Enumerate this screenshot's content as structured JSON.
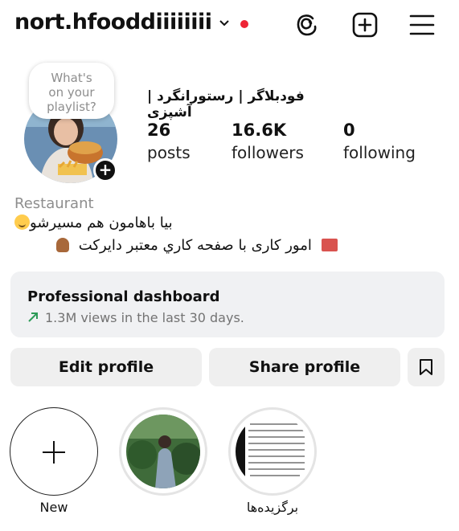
{
  "header": {
    "username": "nort.hfooddiiiiiiii",
    "threads_icon": "threads-icon",
    "create_icon": "plus-square-icon",
    "menu_icon": "hamburger-menu-icon",
    "notification_dot_color": "#ee2435"
  },
  "note": {
    "line1": "What's",
    "line2": "on your",
    "line3": "playlist?"
  },
  "profile": {
    "name": "فودبلاگر | رستورانگرد | آشپزی",
    "stats": [
      {
        "value": "26",
        "label": "posts"
      },
      {
        "value": "16.6K",
        "label": "followers"
      },
      {
        "value": "0",
        "label": "following"
      }
    ],
    "category": "Restaurant",
    "bio_line1": "بیا باهامون هم مسیرشو",
    "bio_line2": "امور کاری با صفحه کاري معتبر دایرکت"
  },
  "dashboard": {
    "title": "Professional dashboard",
    "subtitle": "1.3M views in the last 30 days.",
    "trend_color": "#2e9b58"
  },
  "actions": {
    "edit_label": "Edit profile",
    "share_label": "Share profile",
    "bookmark_icon": "bookmark-icon"
  },
  "highlights": [
    {
      "label": "New"
    },
    {
      "label": ""
    },
    {
      "label": "برگزیده‌ها"
    }
  ]
}
